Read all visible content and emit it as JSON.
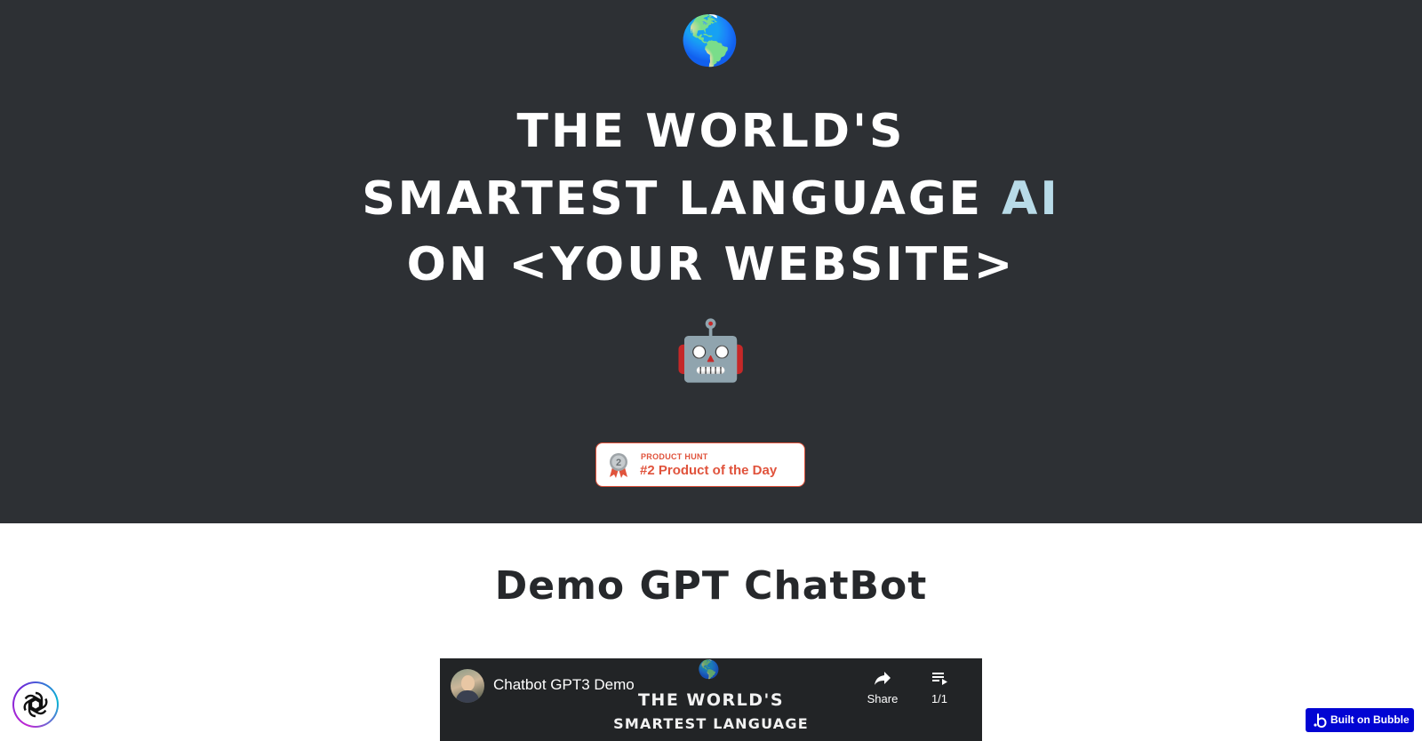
{
  "hero": {
    "globe_emoji": "🌎",
    "headline_line1": "THE WORLD'S",
    "headline_line2_main": "SMARTEST LANGUAGE",
    "headline_line2_accent": "AI",
    "headline_line3": "ON <YOUR WEBSITE>",
    "robot_emoji": "🤖",
    "accent_color": "#b8dbe8",
    "background_color": "#2d3034"
  },
  "product_hunt_badge": {
    "eyebrow": "PRODUCT HUNT",
    "title": "#2 Product of the Day",
    "medal_number": "2",
    "brand_color": "#e0533c"
  },
  "demo_section": {
    "title": "Demo GPT ChatBot"
  },
  "video_embed": {
    "title": "Chatbot GPT3 Demo",
    "share_label": "Share",
    "queue_label": "1/1",
    "frame_line1": "THE WORLD'S",
    "frame_line2": "SMARTEST LANGUAGE",
    "frame_globe": "🌎"
  },
  "floating": {
    "chat_button_icon": "openai-logo-icon",
    "bubble_label": "Built on Bubble",
    "bubble_color": "#0205d3"
  }
}
